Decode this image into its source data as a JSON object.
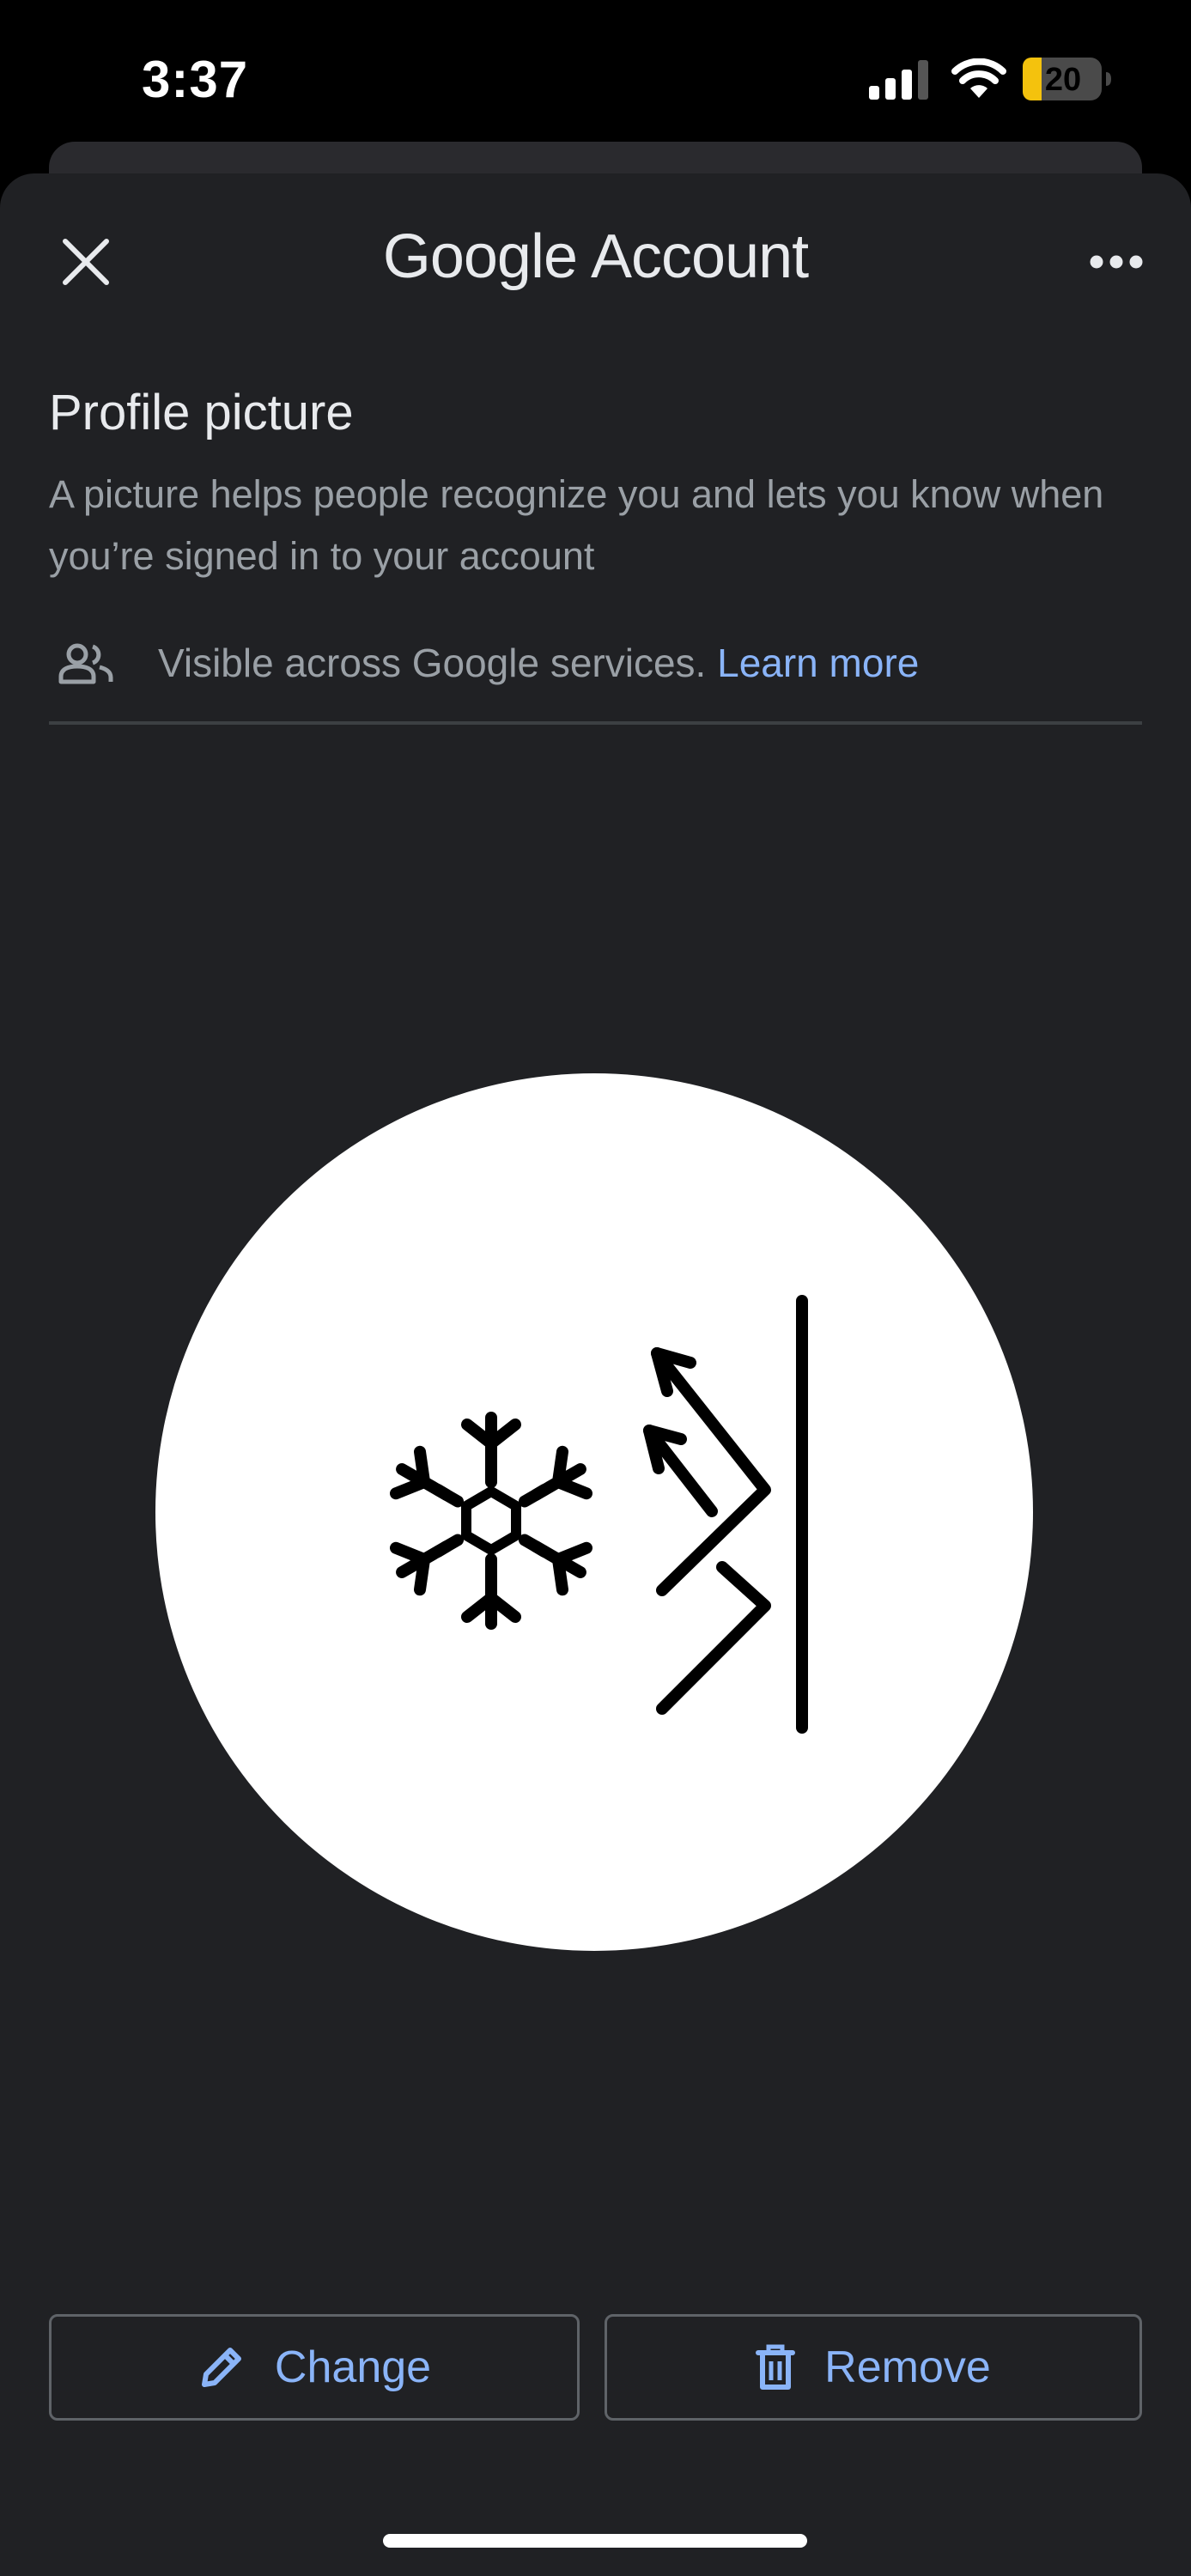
{
  "status_bar": {
    "time": "3:37",
    "battery_level": "20",
    "icons": [
      "signal-icon",
      "wifi-icon",
      "battery-icon"
    ]
  },
  "header": {
    "brand_google": "Google",
    "brand_account": "Account",
    "close_icon": "close-icon",
    "more_icon": "more-options-icon"
  },
  "section": {
    "title": "Profile picture",
    "description": "A picture helps people recognize you and lets you know when you’re signed in to your account",
    "visibility_text": "Visible across Google services.",
    "learn_more": "Learn more",
    "visibility_icon": "people-icon"
  },
  "avatar": {
    "icon": "snowflake-arrow-wall-logo"
  },
  "actions": {
    "change_label": "Change",
    "change_icon": "pencil-icon",
    "remove_label": "Remove",
    "remove_icon": "trash-icon"
  },
  "colors": {
    "background": "#202124",
    "accent": "#8ab4f8",
    "text_primary": "#e8eaed",
    "text_secondary": "#9aa0a6",
    "battery_fill": "#f4c20d"
  }
}
